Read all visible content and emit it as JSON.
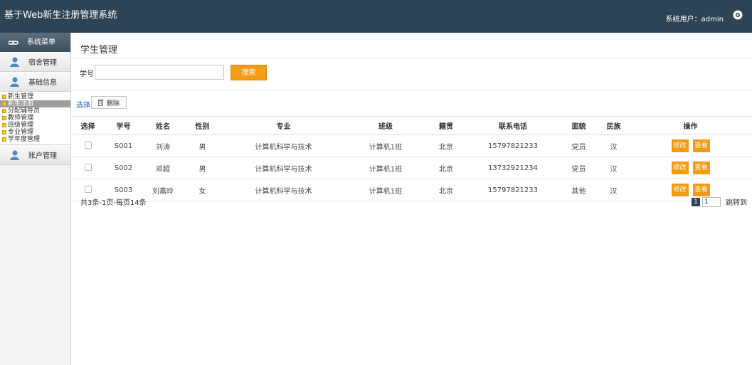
{
  "header": {
    "title": "基于Web新生注册管理系统",
    "user_text": "系统用户：admin",
    "gear_icon": "gear-icon"
  },
  "sidebar": {
    "menu_title": "系统菜单",
    "groups": [
      {
        "label": "宿舍管理",
        "icon": "user-icon"
      },
      {
        "label": "基础信息",
        "icon": "user-icon"
      },
      {
        "label": "账户管理",
        "icon": "user-icon"
      }
    ],
    "items": [
      {
        "label": "新生管理"
      },
      {
        "label": "新生注册"
      },
      {
        "label": "分配辅导员"
      },
      {
        "label": "教师管理"
      },
      {
        "label": "班级管理"
      },
      {
        "label": "专业管理"
      },
      {
        "label": "学年度管理"
      }
    ],
    "item_marker_color": "#f2c62e"
  },
  "page": {
    "title": "学生管理",
    "search": {
      "label": "学号",
      "value": "",
      "button": "搜索"
    },
    "toolbar": {
      "select_label": "选择",
      "delete_label": "删除"
    },
    "table": {
      "columns": [
        "选择",
        "学号",
        "姓名",
        "性别",
        "专业",
        "班级",
        "籍贯",
        "联系电话",
        "面貌",
        "民族",
        "操作"
      ],
      "rows": [
        {
          "id": "S001",
          "name": "刘涛",
          "gender": "男",
          "major": "计算机科学与技术",
          "class": "计算机1班",
          "origin": "北京",
          "phone": "15797821233",
          "politics": "党员",
          "ethnicity": "汉"
        },
        {
          "id": "S002",
          "name": "邓超",
          "gender": "男",
          "major": "计算机科学与技术",
          "class": "计算机1班",
          "origin": "北京",
          "phone": "13732921234",
          "politics": "党员",
          "ethnicity": "汉"
        },
        {
          "id": "S003",
          "name": "刘嘉玲",
          "gender": "女",
          "major": "计算机科学与技术",
          "class": "计算机1班",
          "origin": "北京",
          "phone": "15797821233",
          "politics": "其他",
          "ethnicity": "汉"
        }
      ],
      "edit_label": "修改",
      "view_label": "查看"
    },
    "pagination": {
      "summary": "共3条-1页-每页14条",
      "current_page": "1",
      "page_input": "1",
      "goto_label": "跳转到"
    },
    "accent_color": "#f39c12",
    "header_color": "#2d4356"
  }
}
